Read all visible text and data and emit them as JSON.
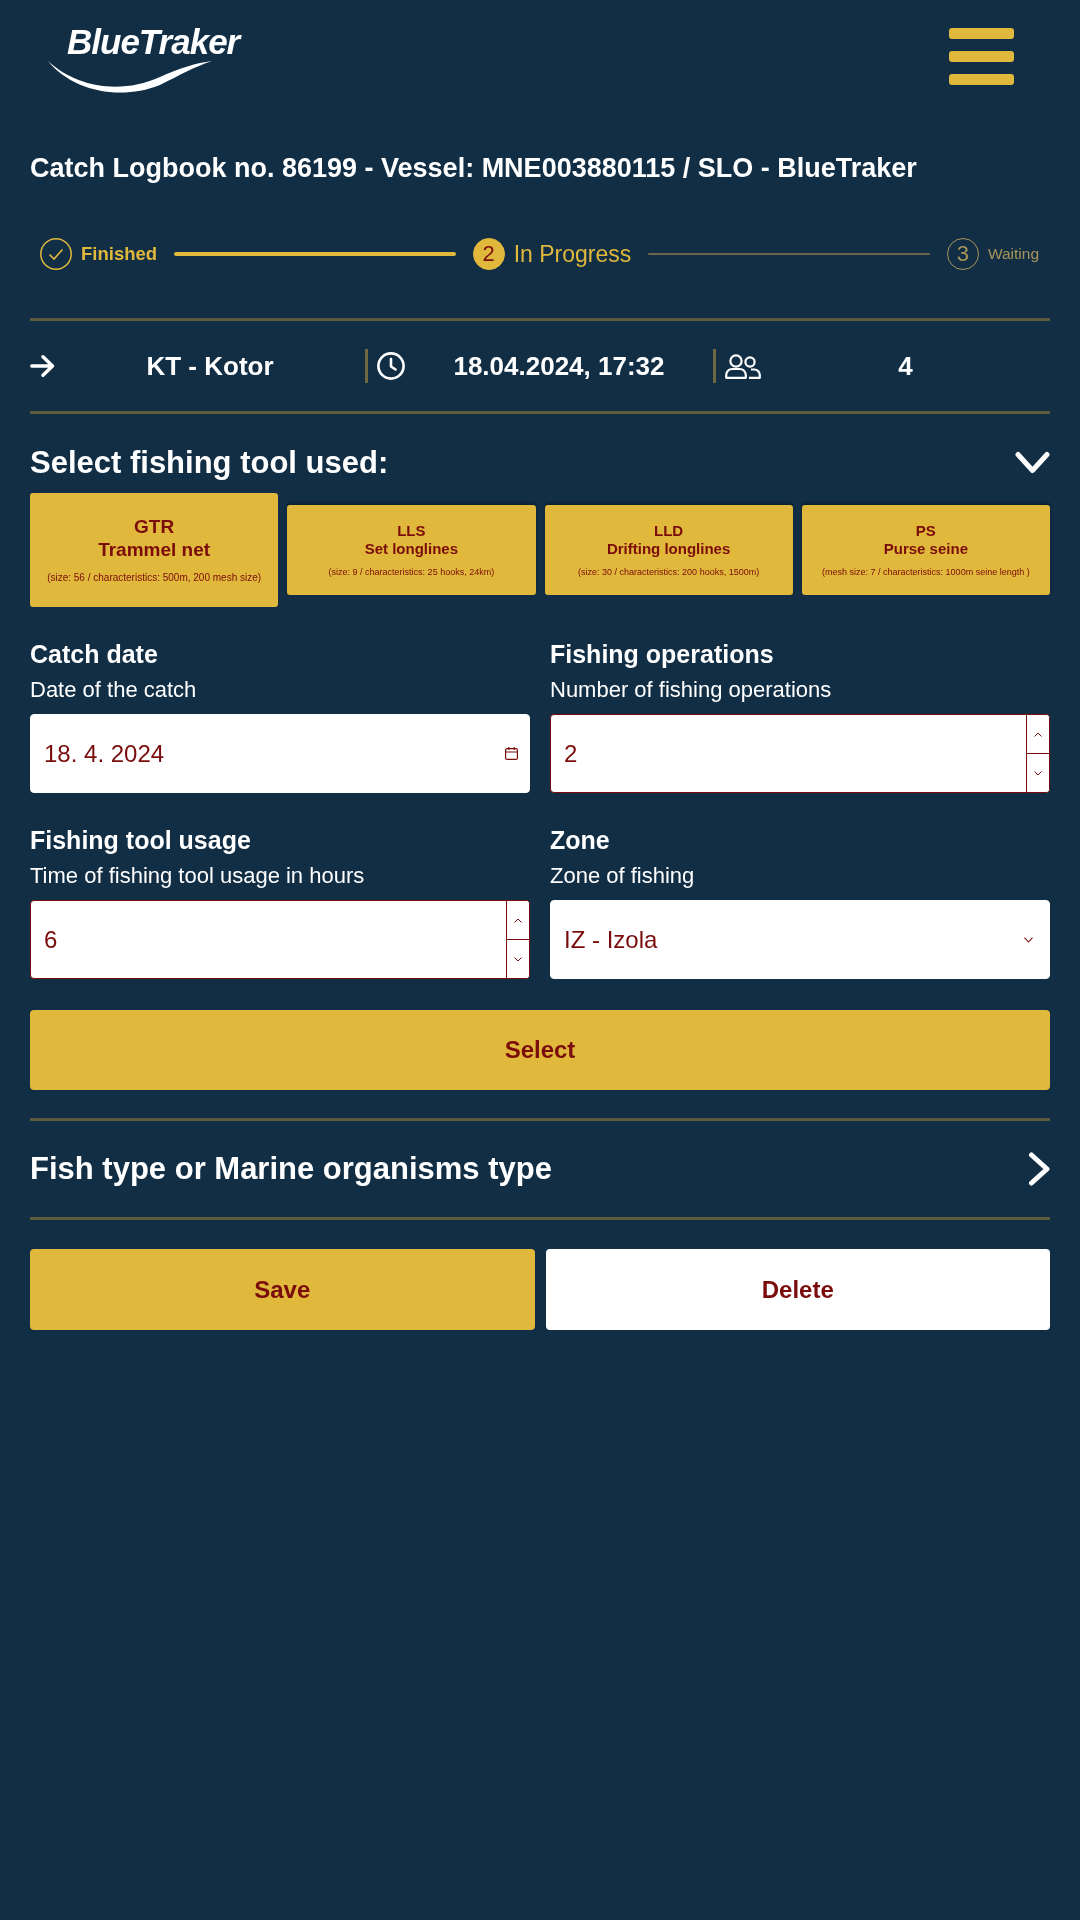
{
  "header": {
    "logo": "BlueTraker"
  },
  "title": "Catch Logbook no. 86199 - Vessel: MNE003880115 / SLO - BlueTraker",
  "steps": [
    {
      "kind": "done",
      "label": "Finished"
    },
    {
      "kind": "current",
      "number": "2",
      "label": "In Progress"
    },
    {
      "kind": "pending",
      "number": "3",
      "label": "Waiting"
    }
  ],
  "trip_info": {
    "port": "KT - Kotor",
    "datetime": "18.04.2024, 17:32",
    "crew": "4"
  },
  "tool_section": {
    "heading": "Select fishing tool used:",
    "expanded": true,
    "tools": [
      {
        "code": "GTR",
        "name": "Trammel net",
        "details": "(size: 56 / characteristics: 500m, 200 mesh size)",
        "selected": true
      },
      {
        "code": "LLS",
        "name": "Set longlines",
        "details": "(size: 9 / characteristics: 25 hooks, 24km)",
        "selected": false
      },
      {
        "code": "LLD",
        "name": "Drifting longlines",
        "details": "(size: 30 / characteristics: 200 hooks, 1500m)",
        "selected": false
      },
      {
        "code": "PS",
        "name": "Purse seine",
        "details": "(mesh size: 7 / characteristics: 1000m seine length )",
        "selected": false
      }
    ]
  },
  "fields": [
    {
      "kind": "date",
      "label": "Catch date",
      "description": "Date of the catch",
      "value": "18. 4. 2024"
    },
    {
      "kind": "number",
      "label": "Fishing operations",
      "description": "Number of fishing operations",
      "value": "2"
    },
    {
      "kind": "number",
      "label": "Fishing tool usage",
      "description": "Time of fishing tool usage in hours",
      "value": "6"
    },
    {
      "kind": "select",
      "label": "Zone",
      "description": "Zone of fishing",
      "value": "IZ - Izola"
    }
  ],
  "select_button": "Select",
  "fish_section": {
    "title": "Fish type or Marine organisms type"
  },
  "actions": [
    {
      "kind": "primary",
      "label": "Save"
    },
    {
      "kind": "secondary",
      "label": "Delete"
    }
  ]
}
